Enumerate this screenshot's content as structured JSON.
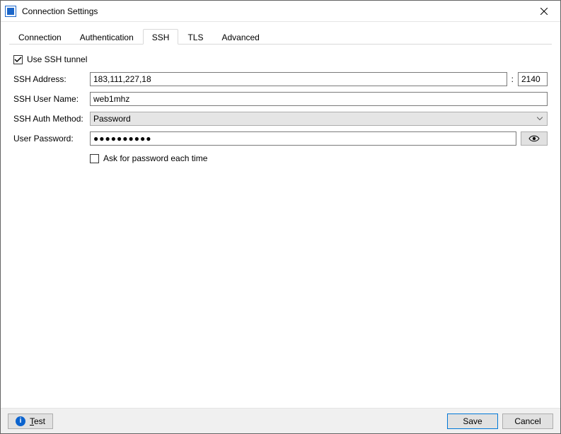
{
  "titlebar": {
    "title": "Connection Settings"
  },
  "tabs": {
    "connection": "Connection",
    "authentication": "Authentication",
    "ssh": "SSH",
    "tls": "TLS",
    "advanced": "Advanced",
    "active": "ssh"
  },
  "ssh": {
    "use_tunnel_label": "Use SSH tunnel",
    "use_tunnel_checked": true,
    "address_label": "SSH Address:",
    "address_value": "183,111,227,18",
    "port_value": "2140",
    "username_label": "SSH User Name:",
    "username_value": "web1mhz",
    "auth_method_label": "SSH Auth Method:",
    "auth_method_value": "Password",
    "password_label": "User Password:",
    "password_mask": "●●●●●●●●●●",
    "ask_each_time_label": "Ask for password each time",
    "ask_each_time_checked": false
  },
  "footer": {
    "test_prefix": "T",
    "test_rest": "est",
    "save": "Save",
    "cancel": "Cancel"
  }
}
